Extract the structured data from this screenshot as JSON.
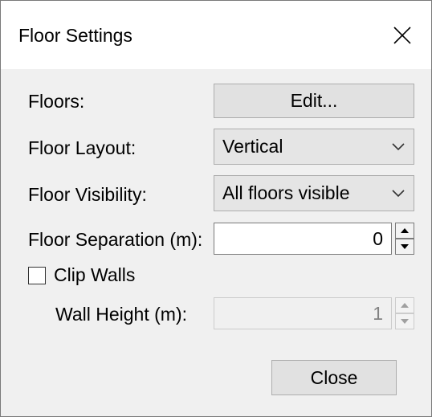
{
  "window": {
    "title": "Floor Settings",
    "close_icon": "close-icon"
  },
  "rows": {
    "floors": {
      "label": "Floors:",
      "button_label": "Edit..."
    },
    "layout": {
      "label": "Floor Layout:",
      "value": "Vertical"
    },
    "visibility": {
      "label": "Floor Visibility:",
      "value": "All floors visible"
    },
    "separation": {
      "label": "Floor Separation (m):",
      "value": "0"
    },
    "clip_walls": {
      "label": "Clip Walls",
      "checked": false
    },
    "wall_height": {
      "label": "Wall Height (m):",
      "value": "1",
      "disabled": true
    }
  },
  "footer": {
    "close_label": "Close"
  }
}
